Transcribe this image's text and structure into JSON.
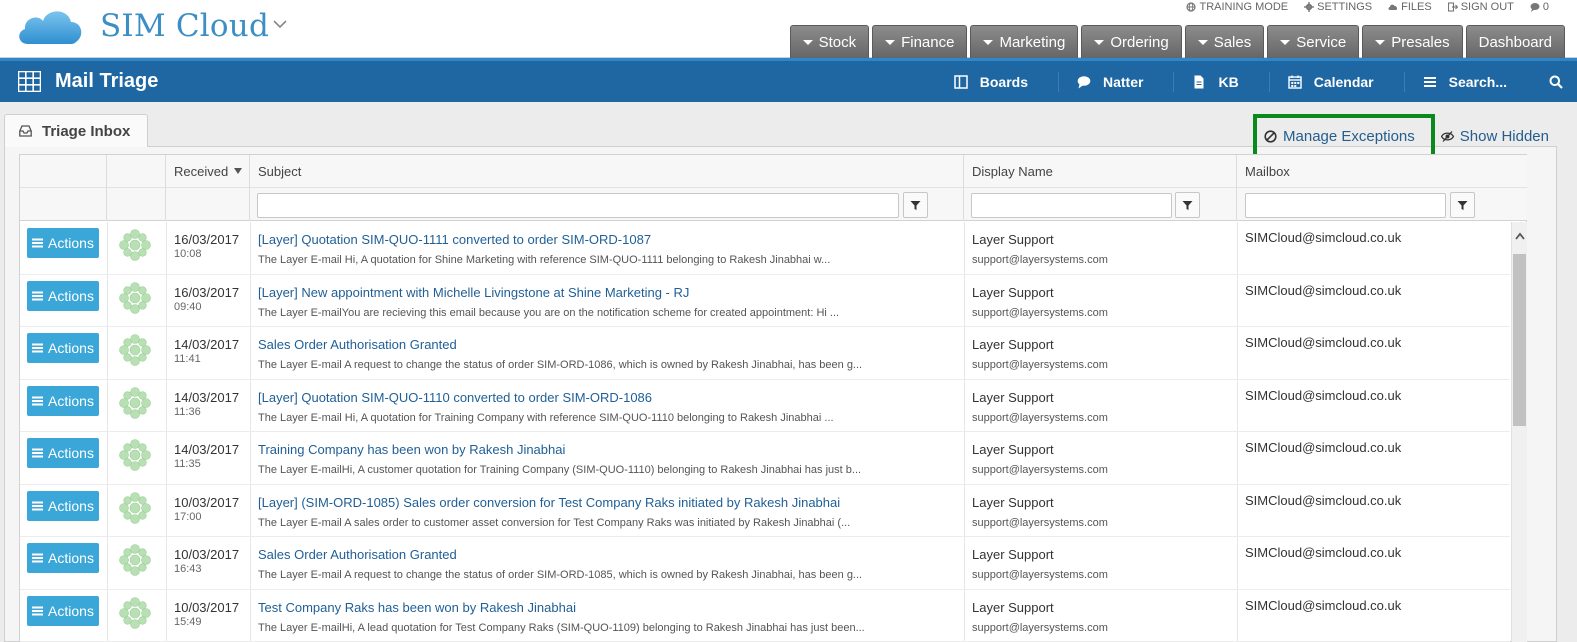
{
  "app": {
    "brand": "SIM Cloud"
  },
  "utility_links": [
    {
      "label": "TRAINING MODE",
      "icon": "globe-icon"
    },
    {
      "label": "SETTINGS",
      "icon": "gear-icon"
    },
    {
      "label": "FILES",
      "icon": "cloud-icon"
    },
    {
      "label": "SIGN OUT",
      "icon": "sign-out-icon"
    },
    {
      "label": "0",
      "icon": "chat-icon"
    }
  ],
  "nav_tabs": [
    {
      "label": "Stock",
      "dropdown": true
    },
    {
      "label": "Finance",
      "dropdown": true
    },
    {
      "label": "Marketing",
      "dropdown": true
    },
    {
      "label": "Ordering",
      "dropdown": true
    },
    {
      "label": "Sales",
      "dropdown": true
    },
    {
      "label": "Service",
      "dropdown": true
    },
    {
      "label": "Presales",
      "dropdown": true
    },
    {
      "label": "Dashboard",
      "dropdown": false
    }
  ],
  "page": {
    "title": "Mail Triage"
  },
  "blue_links": [
    {
      "label": "Boards",
      "icon": "boards-icon"
    },
    {
      "label": "Natter",
      "icon": "chat-bubble-icon"
    },
    {
      "label": "KB",
      "icon": "document-icon"
    },
    {
      "label": "Calendar",
      "icon": "calendar-icon"
    },
    {
      "label": "Search...",
      "icon": "menu-icon"
    }
  ],
  "tab": {
    "label": "Triage Inbox"
  },
  "toolbar": {
    "manage_exceptions": "Manage Exceptions",
    "show_hidden": "Show Hidden"
  },
  "table": {
    "columns": {
      "received": "Received",
      "subject": "Subject",
      "display_name": "Display Name",
      "mailbox": "Mailbox"
    },
    "action_label": "Actions",
    "rows": [
      {
        "date": "16/03/2017",
        "time": "10:08",
        "subject": "[Layer] Quotation SIM-QUO-1111 converted to order SIM-ORD-1087",
        "preview": "The Layer E-mail Hi, A quotation for Shine Marketing with reference SIM-QUO-1111 belonging to Rakesh Jinabhai w...",
        "display_name": "Layer Support",
        "email": "support@layersystems.com",
        "mailbox": "SIMCloud@simcloud.co.uk"
      },
      {
        "date": "16/03/2017",
        "time": "09:40",
        "subject": "[Layer] New appointment with Michelle Livingstone at Shine Marketing - RJ",
        "preview": "The Layer E-mailYou are recieving this email because you are on the notification scheme for created appointment: Hi ...",
        "display_name": "Layer Support",
        "email": "support@layersystems.com",
        "mailbox": "SIMCloud@simcloud.co.uk"
      },
      {
        "date": "14/03/2017",
        "time": "11:41",
        "subject": "Sales Order Authorisation Granted",
        "preview": "The Layer E-mail A request to change the status of order SIM-ORD-1086, which is owned by Rakesh Jinabhai, has been g...",
        "display_name": "Layer Support",
        "email": "support@layersystems.com",
        "mailbox": "SIMCloud@simcloud.co.uk"
      },
      {
        "date": "14/03/2017",
        "time": "11:36",
        "subject": "[Layer] Quotation SIM-QUO-1110 converted to order SIM-ORD-1086",
        "preview": "The Layer E-mail Hi, A quotation for Training Company with reference SIM-QUO-1110 belonging to Rakesh Jinabhai ...",
        "display_name": "Layer Support",
        "email": "support@layersystems.com",
        "mailbox": "SIMCloud@simcloud.co.uk"
      },
      {
        "date": "14/03/2017",
        "time": "11:35",
        "subject": "Training Company has been won by Rakesh Jinabhai",
        "preview": "The Layer E-mailHi, A customer quotation for Training Company (SIM-QUO-1110) belonging to Rakesh Jinabhai has just b...",
        "display_name": "Layer Support",
        "email": "support@layersystems.com",
        "mailbox": "SIMCloud@simcloud.co.uk"
      },
      {
        "date": "10/03/2017",
        "time": "17:00",
        "subject": "[Layer] (SIM-ORD-1085) Sales order conversion for Test Company Raks initiated by Rakesh Jinabhai",
        "preview": "The Layer E-mail A sales order to customer asset conversion for Test Company Raks was initiated by Rakesh Jinabhai (...",
        "display_name": "Layer Support",
        "email": "support@layersystems.com",
        "mailbox": "SIMCloud@simcloud.co.uk"
      },
      {
        "date": "10/03/2017",
        "time": "16:43",
        "subject": "Sales Order Authorisation Granted",
        "preview": "The Layer E-mail A request to change the status of order SIM-ORD-1085, which is owned by Rakesh Jinabhai, has been g...",
        "display_name": "Layer Support",
        "email": "support@layersystems.com",
        "mailbox": "SIMCloud@simcloud.co.uk"
      },
      {
        "date": "10/03/2017",
        "time": "15:49",
        "subject": "Test Company Raks has been won by Rakesh Jinabhai",
        "preview": "The Layer E-mailHi, A lead quotation for Test Company Raks (SIM-QUO-1109) belonging to Rakesh Jinabhai has just been...",
        "display_name": "Layer Support",
        "email": "support@layersystems.com",
        "mailbox": "SIMCloud@simcloud.co.uk"
      }
    ]
  },
  "colors": {
    "brand_blue": "#3b8fc4",
    "bar_blue": "#1e67a3",
    "action_blue": "#3ba6d8",
    "link_blue": "#1f5f96",
    "highlight_green": "#0a8a1d"
  }
}
